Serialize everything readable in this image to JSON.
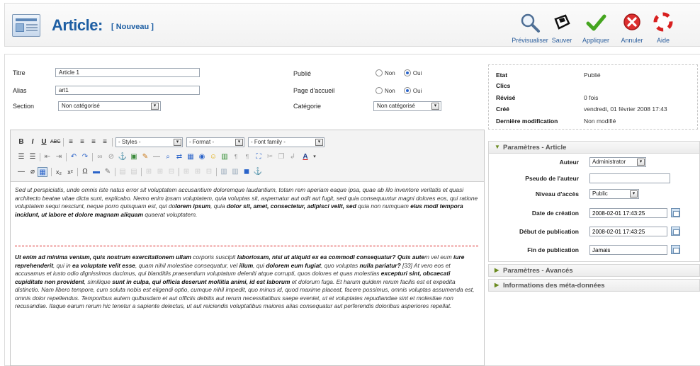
{
  "header": {
    "title": "Article:",
    "subtitle": "[ Nouveau ]"
  },
  "toolbar": {
    "preview": "Prévisualiser",
    "save": "Sauver",
    "apply": "Appliquer",
    "cancel": "Annuler",
    "help": "Aide"
  },
  "form": {
    "title_label": "Titre",
    "title_value": "Article 1",
    "alias_label": "Alias",
    "alias_value": "art1",
    "section_label": "Section",
    "section_value": "Non catégorisé",
    "published_label": "Publié",
    "frontpage_label": "Page d'accueil",
    "category_label": "Catégorie",
    "category_value": "Non catégorisé",
    "no_label": "Non",
    "yes_label": "Oui"
  },
  "editor": {
    "styles": "- Styles -",
    "format": "- Format -",
    "font_family": "- Font family -",
    "p1": [
      {
        "t": "Sed ut perspiciatis, unde omnis iste natus error sit voluptatem accusantium doloremque laudantium, totam rem aperiam eaque ipsa, quae ab illo inventore veritatis et quasi architecto beatae vitae dicta sunt, explicabo. Nemo enim ipsam voluptatem, quia voluptas sit, aspernatur aut odit aut fugit, sed quia consequuntur magni dolores eos, qui ratione voluptatem sequi nesciunt, neque porro quisquam est, qui do",
        "b": false
      },
      {
        "t": "lorem ipsum",
        "b": true
      },
      {
        "t": ", quia ",
        "b": false
      },
      {
        "t": "dolor sit, amet, consectetur, adipisci velit, sed",
        "b": true
      },
      {
        "t": " quia non numquam ",
        "b": false
      },
      {
        "t": "eius modi tempora incidunt, ut labore et dolore magnam aliquam",
        "b": true
      },
      {
        "t": " quaerat voluptatem.",
        "b": false
      }
    ],
    "p2": [
      {
        "t": "Ut enim ad minima veniam, quis nostrum exercitationem ullam",
        "b": true
      },
      {
        "t": " corporis suscipit ",
        "b": false
      },
      {
        "t": "laboriosam, nisi ut aliquid ex ea commodi consequatur? Quis aute",
        "b": true
      },
      {
        "t": "m vel eum ",
        "b": false
      },
      {
        "t": "iure reprehenderit",
        "b": true
      },
      {
        "t": ", qui in ",
        "b": false
      },
      {
        "t": "ea voluptate velit esse",
        "b": true
      },
      {
        "t": ", quam nihil molestiae consequatur, vel ",
        "b": false
      },
      {
        "t": "illum",
        "b": true
      },
      {
        "t": ", qui ",
        "b": false
      },
      {
        "t": "dolorem eum fugiat",
        "b": true
      },
      {
        "t": ", quo voluptas ",
        "b": false
      },
      {
        "t": "nulla pariatur?",
        "b": true
      },
      {
        "t": " [33] At vero eos et accusamus et iusto odio dignissimos ducimus, qui blanditiis praesentium voluptatum deleniti atque corrupti, quos dolores et quas molestias ",
        "b": false
      },
      {
        "t": "excepturi sint, obcaecati cupiditate non provident",
        "b": true
      },
      {
        "t": ", similique ",
        "b": false
      },
      {
        "t": "sunt in culpa, qui officia deserunt mollitia animi, id est laborum",
        "b": true
      },
      {
        "t": " et dolorum fuga. Et harum quidem rerum facilis est et expedita distinctio. Nam libero tempore, cum soluta nobis est eligendi optio, cumque nihil impedit, quo minus id, quod maxime placeat, facere possimus, omnis voluptas assumenda est, omnis dolor repellendus. Temporibus autem quibusdam et aut officiis debitis aut rerum necessitatibus saepe eveniet, ut et voluptates repudiandae sint et molestiae non recusandae. Itaque earum rerum hic tenetur a sapiente delectus, ut aut reiciendis voluptatibus maiores alias consequatur aut perferendis doloribus asperiores repellat.",
        "b": false
      }
    ]
  },
  "info": {
    "state_k": "Etat",
    "state_v": "Publié",
    "hits_k": "Clics",
    "hits_v": "",
    "revised_k": "Révisé",
    "revised_v": "0 fois",
    "created_k": "Créé",
    "created_v": "vendredi, 01 février 2008 17:43",
    "modified_k": "Dernière modification",
    "modified_v": "Non modifié"
  },
  "params": {
    "heading": "Paramètres - Article",
    "author_k": "Auteur",
    "author_v": "Administrator",
    "alias_k": "Pseudo de l'auteur",
    "alias_v": "",
    "access_k": "Niveau d'accès",
    "access_v": "Public",
    "created_k": "Date de création",
    "created_v": "2008-02-01 17:43:25",
    "start_k": "Début de publication",
    "start_v": "2008-02-01 17:43:25",
    "end_k": "Fin de publication",
    "end_v": "Jamais"
  },
  "panels": {
    "advanced": "Paramètres - Avancés",
    "meta": "Informations des méta-données"
  }
}
